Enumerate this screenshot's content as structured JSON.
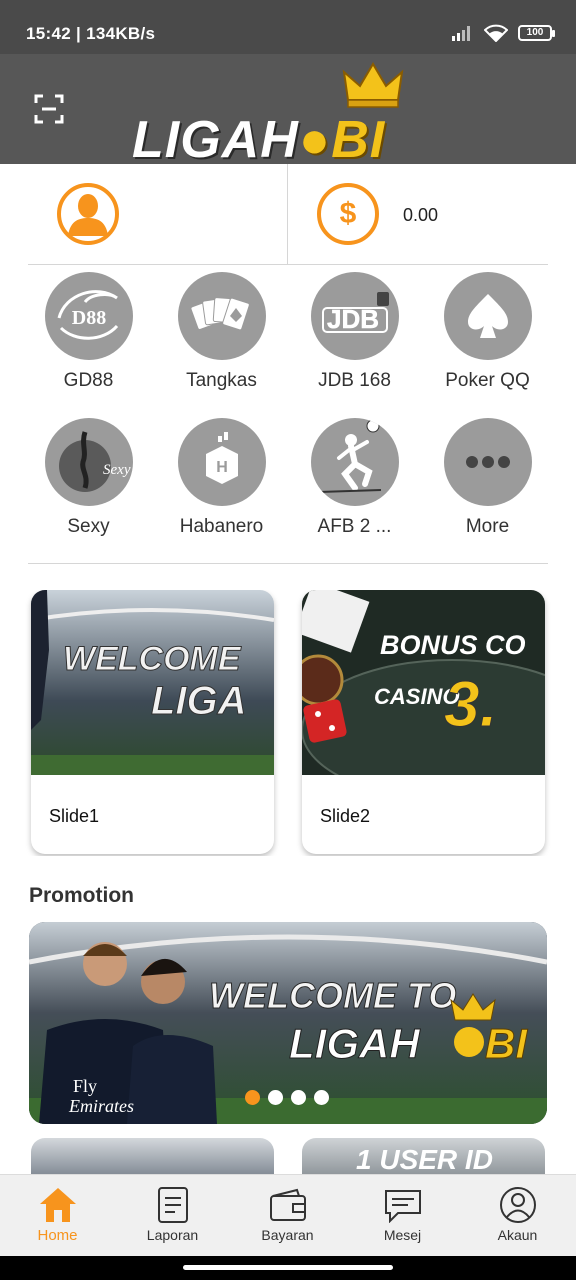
{
  "status_bar": {
    "time": "15:42 | 134KB/s",
    "battery": "100"
  },
  "header": {
    "logo_part1": "LIGAH",
    "logo_part2": "BI",
    "logo_text": "LIGAHOBI"
  },
  "account": {
    "balance": "0.00"
  },
  "games": [
    {
      "label": "GD88",
      "icon": "gd88-dragon-icon",
      "logo_text": "D88"
    },
    {
      "label": "Tangkas",
      "icon": "playing-cards-icon"
    },
    {
      "label": "JDB 168",
      "icon": "jdb-slot-icon",
      "logo_text": "JDB"
    },
    {
      "label": "Poker QQ",
      "icon": "spade-icon"
    },
    {
      "label": "Sexy",
      "icon": "sexy-dancer-icon",
      "logo_text": "Sexy"
    },
    {
      "label": "Habanero",
      "icon": "habanero-icon",
      "logo_text": "H"
    },
    {
      "label": "AFB 2 ...",
      "icon": "football-player-icon"
    },
    {
      "label": "More",
      "icon": "more-dots-icon"
    }
  ],
  "slides": [
    {
      "caption": "Slide1",
      "line1": "WELCOME",
      "line2": "LIGA"
    },
    {
      "caption": "Slide2",
      "line1": "BONUS CO",
      "line2": "CASINO",
      "big": "3."
    }
  ],
  "promotion": {
    "title": "Promotion",
    "banner_line1": "WELCOME TO",
    "banner_line2": "LIGAH",
    "banner_line3": "BI",
    "sponsor": "Fly Emirates",
    "sponsor_line1": "Fly",
    "sponsor_line2": "Emirates",
    "dots_count": 4,
    "active_dot": 0
  },
  "bottom_peek": {
    "right_text": "1 USER ID"
  },
  "tabs": [
    {
      "label": "Home",
      "icon": "home-icon",
      "active": true
    },
    {
      "label": "Laporan",
      "icon": "report-icon",
      "active": false
    },
    {
      "label": "Bayaran",
      "icon": "wallet-icon",
      "active": false
    },
    {
      "label": "Mesej",
      "icon": "message-icon",
      "active": false
    },
    {
      "label": "Akaun",
      "icon": "account-icon",
      "active": false
    }
  ],
  "colors": {
    "accent": "#f7941d",
    "header_bg": "#575757",
    "statusbar_bg": "#4a4a4a",
    "icon_gray": "#9b9b9b"
  }
}
